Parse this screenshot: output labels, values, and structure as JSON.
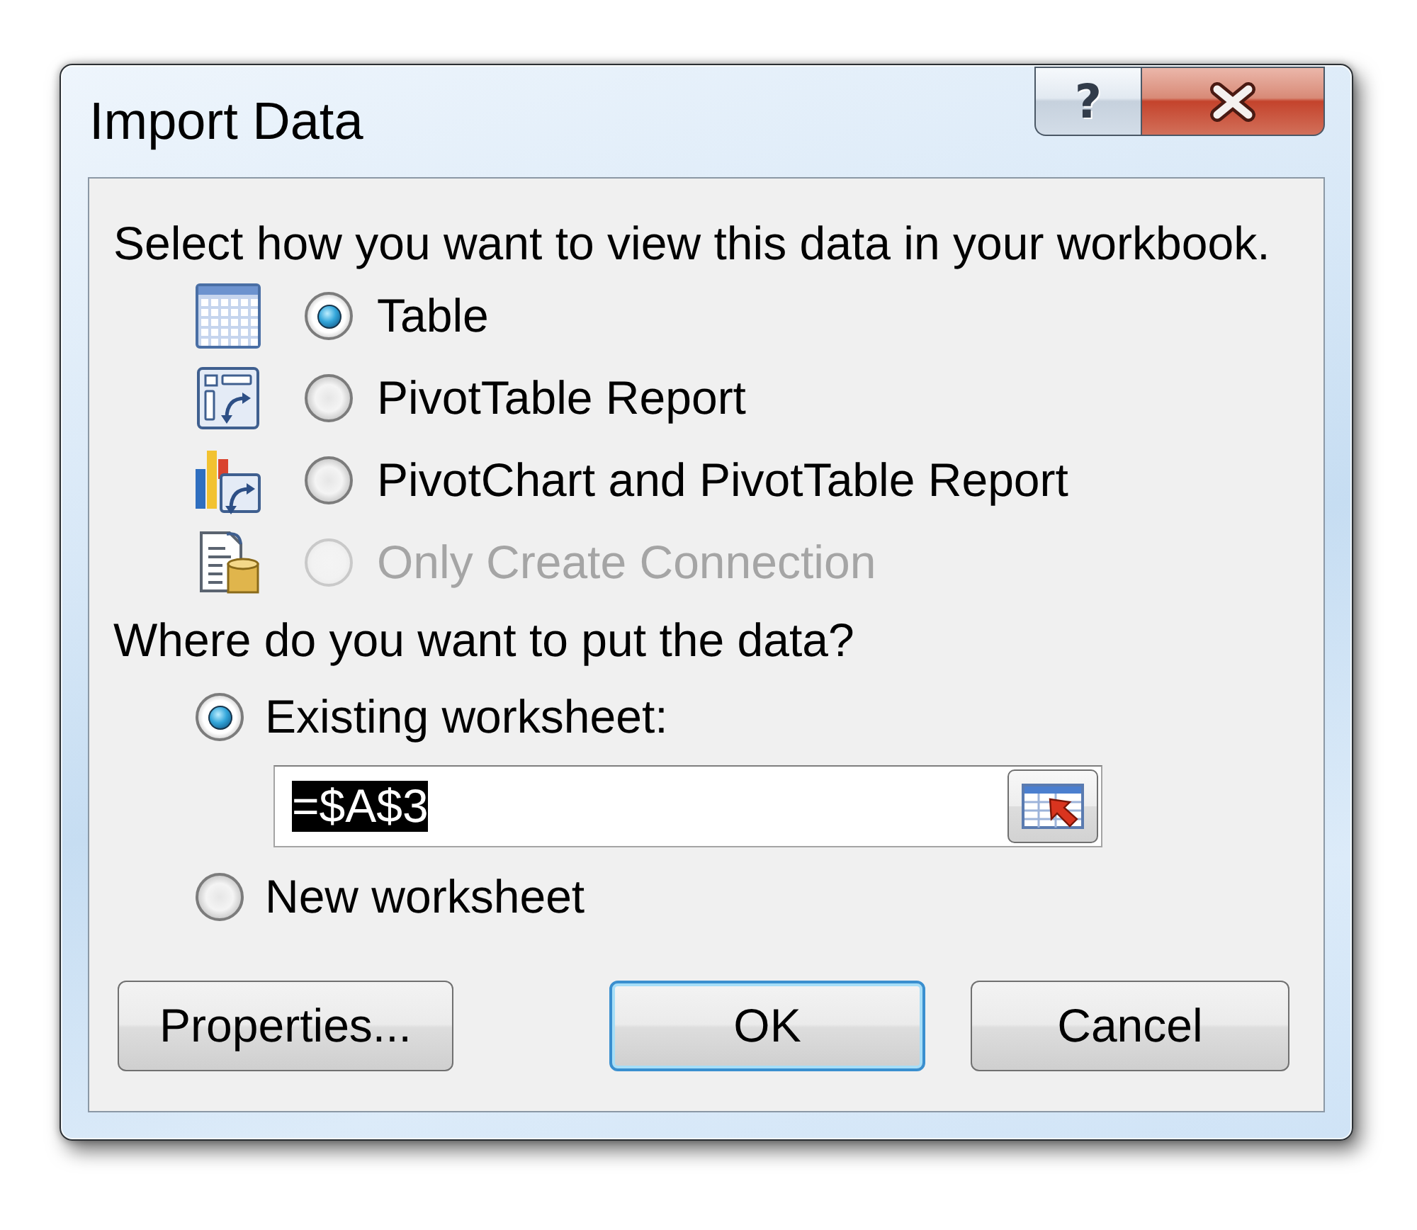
{
  "window": {
    "title": "Import Data",
    "caption_buttons": [
      {
        "kind": "help",
        "label": "?"
      },
      {
        "kind": "close"
      }
    ]
  },
  "view_prompt": "Select how you want to view this data in your workbook.",
  "view_options": [
    {
      "kind": "table",
      "label": "Table",
      "selected": true,
      "disabled": false
    },
    {
      "kind": "pivottable",
      "label": "PivotTable Report",
      "selected": false,
      "disabled": false
    },
    {
      "kind": "pivotchart",
      "label": "PivotChart and PivotTable Report",
      "selected": false,
      "disabled": false
    },
    {
      "kind": "connection",
      "label": "Only Create Connection",
      "selected": false,
      "disabled": true
    }
  ],
  "location_prompt": "Where do you want to put the data?",
  "location_options": [
    {
      "label": "Existing worksheet:",
      "selected": true,
      "field": {
        "value": "=$A$3",
        "highlighted": true
      }
    },
    {
      "label": "New worksheet",
      "selected": false
    }
  ],
  "buttons": [
    {
      "kind": "properties",
      "label": "Properties...",
      "default": false
    },
    {
      "kind": "ok",
      "label": "OK",
      "default": true
    },
    {
      "kind": "cancel",
      "label": "Cancel",
      "default": false
    }
  ]
}
